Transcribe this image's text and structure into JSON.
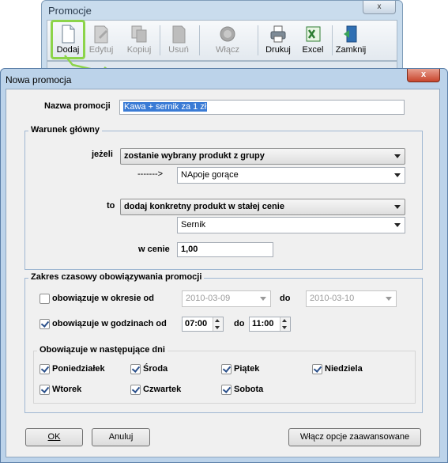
{
  "background_window": {
    "title": "Promocje",
    "close_label": "x",
    "toolbar": [
      {
        "label": "Dodaj",
        "enabled": true
      },
      {
        "label": "Edytuj",
        "enabled": false
      },
      {
        "label": "Kopiuj",
        "enabled": false
      },
      {
        "label": "Usuń",
        "enabled": false
      },
      {
        "label": "Włącz",
        "enabled": false
      },
      {
        "label": "Drukuj",
        "enabled": true
      },
      {
        "label": "Excel",
        "enabled": true
      },
      {
        "label": "Zamknij",
        "enabled": true
      }
    ]
  },
  "dialog": {
    "title": "Nowa promocja",
    "close_label": "x",
    "name_label": "Nazwa promocji",
    "name_value": "Kawa + sernik za 1 zł",
    "main_condition": {
      "title": "Warunek główny",
      "if_label": "jeżeli",
      "if_value": "zostanie wybrany produkt z grupy",
      "arrow_label": "------->",
      "group_value": "NApoje gorące",
      "to_label": "to",
      "to_value": "dodaj konkretny produkt w stałej cenie",
      "product_value": "Sernik",
      "price_label": "w cenie",
      "price_value": "1,00"
    },
    "time_range": {
      "title": "Zakres czasowy obowiązywania promocji",
      "period_label": "obowiązuje w okresie od",
      "period_checked": false,
      "date_from": "2010-03-09",
      "date_to_label": "do",
      "date_to": "2010-03-10",
      "hours_label": "obowiązuje w godzinach od",
      "hours_checked": true,
      "hour_from": "07:00",
      "hour_to_label": "do",
      "hour_to": "11:00",
      "days_title": "Obowiązuje w następujące dni",
      "days": [
        {
          "label": "Poniedziałek",
          "checked": true
        },
        {
          "label": "Środa",
          "checked": true
        },
        {
          "label": "Piątek",
          "checked": true
        },
        {
          "label": "Niedziela",
          "checked": true
        },
        {
          "label": "Wtorek",
          "checked": true
        },
        {
          "label": "Czwartek",
          "checked": true
        },
        {
          "label": "Sobota",
          "checked": true
        }
      ]
    },
    "buttons": {
      "ok": "OK",
      "cancel": "Anuluj",
      "advanced": "Włącz opcje zaawansowane"
    }
  },
  "colors": {
    "accent_highlight": "#8cd44a",
    "selection": "#3a7bd5"
  }
}
